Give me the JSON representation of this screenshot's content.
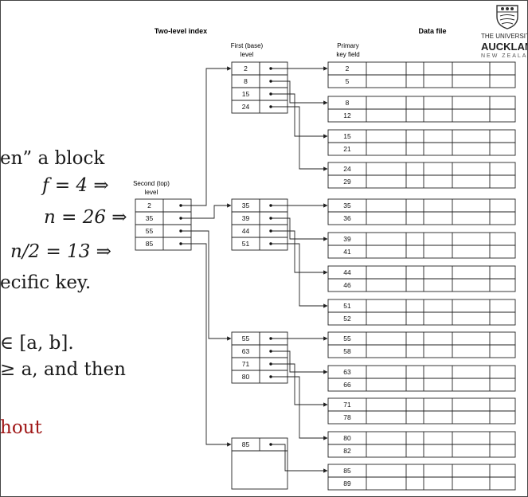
{
  "slide": {
    "line1": "en” a block",
    "eq1": "f = 4 ⇒",
    "eq2": "n = 26 ⇒",
    "eq3": "n/2 = 13 ⇒",
    "line2": "ecific key.",
    "line3": "∈ [a, b].",
    "line4": "≥ a, and then",
    "line5": "hout"
  },
  "logo": {
    "line1": "THE UNIVERSITY",
    "line2": "AUCKLAN",
    "line3": "NEW ZEALA"
  },
  "diagram": {
    "title_index": "Two-level index",
    "title_data": "Data file",
    "first_level_label_1": "First (base)",
    "first_level_label_2": "level",
    "primary_key_label_1": "Primary",
    "primary_key_label_2": "key field",
    "second_level_label_1": "Second (top)",
    "second_level_label_2": "level",
    "second_level_keys": [
      "2",
      "35",
      "55",
      "85"
    ],
    "first_level_blocks": [
      [
        "2",
        "8",
        "15",
        "24"
      ],
      [
        "35",
        "39",
        "44",
        "51"
      ],
      [
        "55",
        "63",
        "71",
        "80"
      ],
      [
        "85"
      ]
    ],
    "data_blocks": [
      [
        "2",
        "5"
      ],
      [
        "8",
        "12"
      ],
      [
        "15",
        "21"
      ],
      [
        "24",
        "29"
      ],
      [
        "35",
        "36"
      ],
      [
        "39",
        "41"
      ],
      [
        "44",
        "46"
      ],
      [
        "51",
        "52"
      ],
      [
        "55",
        "58"
      ],
      [
        "63",
        "66"
      ],
      [
        "71",
        "78"
      ],
      [
        "80",
        "82"
      ],
      [
        "85",
        "89"
      ]
    ]
  }
}
